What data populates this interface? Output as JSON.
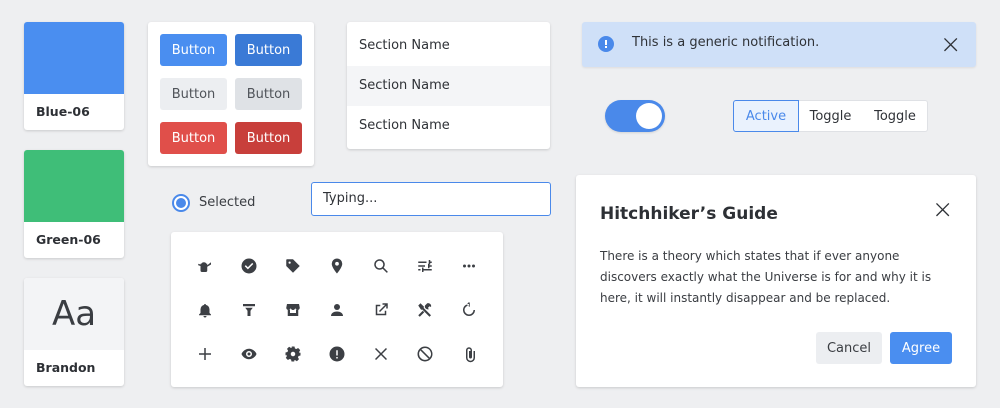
{
  "swatches": [
    {
      "label": "Blue-06",
      "color": "#4a8ef0"
    },
    {
      "label": "Green-06",
      "color": "#3fbe78"
    },
    {
      "label": "Brandon",
      "sample": "Aa"
    }
  ],
  "buttons": {
    "row1": [
      "Button",
      "Button"
    ],
    "row2": [
      "Button",
      "Button"
    ],
    "row3": [
      "Button",
      "Button"
    ]
  },
  "sections": [
    "Section Name",
    "Section Name",
    "Section Name"
  ],
  "notification": {
    "text": "This is a generic notification."
  },
  "toggle": {
    "on": true
  },
  "segmented": [
    "Active",
    "Toggle",
    "Toggle"
  ],
  "radio": {
    "label": "Selected"
  },
  "input": {
    "value": "Typing..."
  },
  "icons": [
    "watering-can-icon",
    "check-circle-icon",
    "tag-icon",
    "map-pin-icon",
    "search-icon",
    "sliders-icon",
    "more-horizontal-icon",
    "bell-icon",
    "filter-icon",
    "store-icon",
    "user-icon",
    "external-link-icon",
    "tools-icon",
    "refresh-icon",
    "plus-icon",
    "eye-icon",
    "gear-icon",
    "alert-circle-icon",
    "close-icon",
    "block-icon",
    "paperclip-icon"
  ],
  "dialog": {
    "title": "Hitchhiker’s Guide",
    "body": "There is a theory which states that if ever anyone discovers exactly what the Universe is for and why it is here, it will instantly disappear and be replaced.",
    "cancel": "Cancel",
    "agree": "Agree"
  },
  "colors": {
    "accent": "#4a89ea",
    "danger": "#dd4b47",
    "notification_bg": "#cfe0f8"
  }
}
